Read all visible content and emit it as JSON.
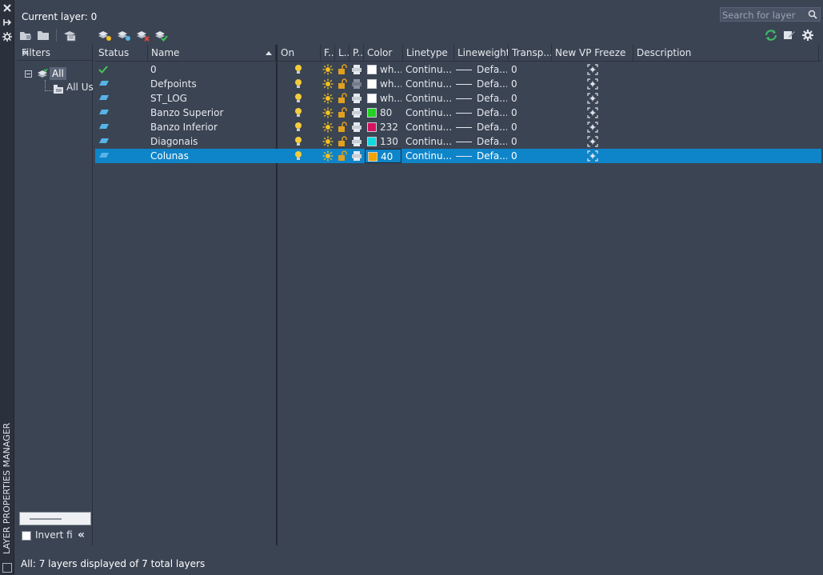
{
  "window": {
    "vertical_title": "LAYER PROPERTIES MANAGER",
    "strip_icons": [
      "close-icon",
      "pin-icon",
      "properties-icon"
    ]
  },
  "header": {
    "current_layer_label": "Current layer: 0",
    "search_placeholder": "Search for layer"
  },
  "toolbar_left": [
    "new-property-filter-icon",
    "new-group-filter-icon",
    "layer-states-manager-icon",
    "new-layer-icon",
    "new-layer-vp-frozen-icon",
    "delete-layer-icon",
    "set-current-icon"
  ],
  "toolbar_right": [
    "refresh-icon",
    "layer-settings-icon",
    "settings-gear-icon"
  ],
  "filters": {
    "title": "Filters",
    "tree": [
      {
        "label": "All",
        "selected": true
      },
      {
        "label": "All Us"
      }
    ],
    "invert_label": "Invert fi"
  },
  "columns": {
    "status": "Status",
    "name": "Name",
    "on": "On",
    "freeze": "F..",
    "lock": "L..",
    "plot": "P..",
    "color": "Color",
    "linetype": "Linetype",
    "lineweight": "Lineweight",
    "transparency": "Transp...",
    "vp_freeze": "New VP Freeze",
    "description": "Description"
  },
  "layers": [
    {
      "status": "current",
      "name": "0",
      "color_hex": "#ffffff",
      "color_label": "wh...",
      "linetype": "Continu...",
      "lineweight": "Defa...",
      "transparency": "0",
      "selected": false
    },
    {
      "status": "layer",
      "name": "Defpoints",
      "color_hex": "#ffffff",
      "color_label": "wh...",
      "linetype": "Continu...",
      "lineweight": "Defa...",
      "transparency": "0",
      "selected": false
    },
    {
      "status": "layer",
      "name": "ST_LOG",
      "color_hex": "#ffffff",
      "color_label": "wh...",
      "linetype": "Continu...",
      "lineweight": "Defa...",
      "transparency": "0",
      "selected": false
    },
    {
      "status": "layer",
      "name": "Banzo Superior",
      "color_hex": "#22d222",
      "color_label": "80",
      "linetype": "Continu...",
      "lineweight": "Defa...",
      "transparency": "0",
      "selected": false
    },
    {
      "status": "layer",
      "name": "Banzo Inferior",
      "color_hex": "#d4135f",
      "color_label": "232",
      "linetype": "Continu...",
      "lineweight": "Defa...",
      "transparency": "0",
      "selected": false
    },
    {
      "status": "layer",
      "name": "Diagonais",
      "color_hex": "#12d8e0",
      "color_label": "130",
      "linetype": "Continu...",
      "lineweight": "Defa...",
      "transparency": "0",
      "selected": false
    },
    {
      "status": "layer",
      "name": "Colunas",
      "color_hex": "#f0a500",
      "color_label": "40",
      "linetype": "Continu...",
      "lineweight": "Defa...",
      "transparency": "0",
      "selected": true
    }
  ],
  "status_bar": "All: 7 layers displayed of 7 total layers",
  "colors": {
    "background": "#3b4453",
    "selected_row": "#0f85c9",
    "current_check": "#44c25a",
    "bulb": "#f5cc3c",
    "sun": "#f0c020",
    "lock": "#e0a020"
  }
}
